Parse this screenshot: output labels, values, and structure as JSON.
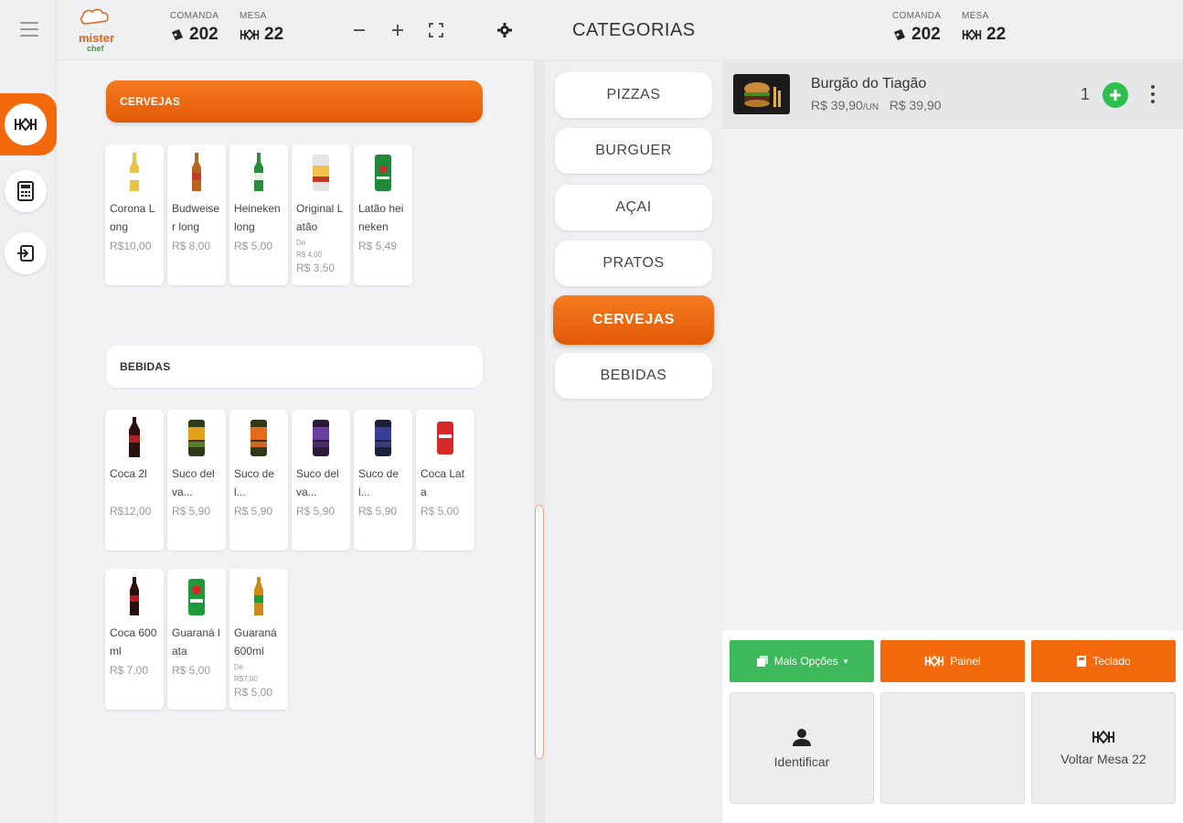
{
  "header": {
    "comanda_label": "COMANDA",
    "comanda_value": "202",
    "mesa_label": "MESA",
    "mesa_value": "22"
  },
  "logo": {
    "line1": "mister",
    "line2": "chef"
  },
  "sections": [
    {
      "title": "CERVEJAS",
      "products": [
        {
          "name": "Corona Long",
          "price": "R$10,00",
          "color": "#e8c24a"
        },
        {
          "name": "Budweiser long",
          "price": "R$ 8,00",
          "color": "#c0392b"
        },
        {
          "name": "Heineken long",
          "price": "R$ 5,00",
          "color": "#2e8b3a"
        },
        {
          "name": "Original Latão",
          "from_label": "De",
          "old_price": "R$ 4,00",
          "price": "R$ 3,50",
          "color": "#d9d9d9"
        },
        {
          "name": "Latão heineken",
          "price": "R$ 5,49",
          "color": "#1f8a3a"
        }
      ]
    },
    {
      "title": "BEBIDAS",
      "products": [
        {
          "name": "Coca 2l",
          "price": "R$12,00",
          "color": "#b01e23"
        },
        {
          "name": "Suco del va...",
          "price": "R$ 5,90",
          "color": "#5a7d2a"
        },
        {
          "name": "Suco del...",
          "price": "R$ 5,90",
          "color": "#d2691e"
        },
        {
          "name": "Suco del va...",
          "price": "R$ 5,90",
          "color": "#4b2c6b"
        },
        {
          "name": "Suco del...",
          "price": "R$ 5,90",
          "color": "#3a3f7a"
        },
        {
          "name": "Coca Lata",
          "price": "R$ 5,00",
          "color": "#d62828"
        },
        {
          "name": "Coca 600ml",
          "price": "R$ 7,00",
          "color": "#b01e23"
        },
        {
          "name": "Guaraná lata",
          "price": "R$ 5,00",
          "color": "#1e9a3a"
        },
        {
          "name": "Guaraná 600ml",
          "from_label": "De",
          "old_price": "R$7,00",
          "price": "R$ 5,00",
          "color": "#c98a1a"
        }
      ]
    }
  ],
  "categories": {
    "title": "CATEGORIAS",
    "items": [
      "PIZZAS",
      "BURGUER",
      "AÇAI",
      "PRATOS",
      "CERVEJAS",
      "BEBIDAS"
    ],
    "active": "CERVEJAS"
  },
  "order": {
    "item_name": "Burgão do Tiagão",
    "unit_price": "R$ 39,90",
    "unit_suffix": "/UN",
    "total": "R$ 39,90",
    "quantity": "1"
  },
  "actions": {
    "more_options": "Mais Opções",
    "panel": "Painel",
    "keypad": "Teclado",
    "identify": "Identificar",
    "back_table": "Voltar Mesa 22"
  },
  "colors": {
    "accent": "#f26a0c",
    "green": "#3db85a"
  }
}
